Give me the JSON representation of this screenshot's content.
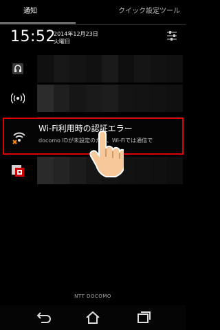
{
  "tabs": {
    "notifications": "通知",
    "quick_settings": "クイック設定ツール"
  },
  "status": {
    "time": "15:52",
    "date": "2014年12月23日",
    "weekday": "火曜日"
  },
  "notifications": [
    {
      "icon": "headset-icon",
      "colors": [
        "#101010",
        "#181818",
        "#141414",
        "#111111",
        "#1a1a1a",
        "#0f0f0f",
        "#151515",
        "#121212",
        "#101010"
      ]
    },
    {
      "icon": "signal-broadcast-icon",
      "colors": [
        "#2c2c2c",
        "#1f1f1f",
        "#161616",
        "#1a1a1a",
        "#1d1d1d",
        "#141414",
        "#131313",
        "#121212",
        "#101010"
      ]
    },
    {
      "icon": "shield-app-icon",
      "colors": [
        "#2a2a2a",
        "#242424",
        "#1c1c1c",
        "#161616",
        "#141414",
        "#121212",
        "#111111",
        "#101010",
        "#0e0e0e"
      ]
    }
  ],
  "wifi_notification": {
    "icon": "wifi-error-icon",
    "title": "Wi-Fi利用時の認証エラー",
    "subtitle": "docomo IDが未設定のため、Wi-Fiでは通信で"
  },
  "carrier": "NTT DOCOMO",
  "navbar": {
    "back": "back-icon",
    "home": "home-icon",
    "recents": "recents-icon"
  },
  "colors": {
    "highlight": "#e00000",
    "background": "#000000"
  }
}
